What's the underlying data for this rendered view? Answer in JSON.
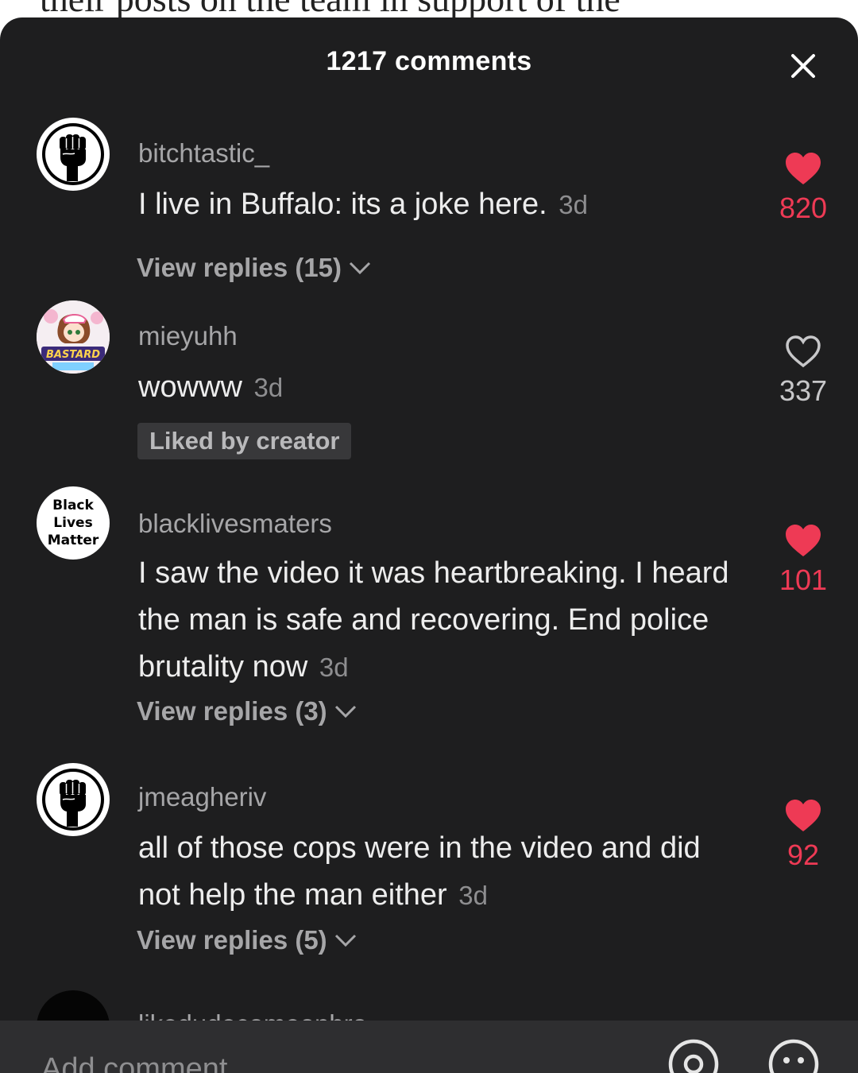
{
  "background_article": {
    "text": "their posts on the team in support of the"
  },
  "header": {
    "title": "1217 comments"
  },
  "comments": [
    {
      "username": "bitchtastic_",
      "text": "I live in Buffalo: its a joke here.",
      "time": "3d",
      "likes": "820",
      "liked": true,
      "view_replies": "View replies (15)",
      "avatar": "raised-fist"
    },
    {
      "username": "mieyuhh",
      "text": "wowww",
      "time": "3d",
      "likes": "337",
      "liked": false,
      "badge": "Liked by creator",
      "avatar": "anime-character",
      "avatar_text": "BASTARD"
    },
    {
      "username": "blacklivesmaters",
      "text": "I saw the video it was heartbreaking. I heard the man is safe and recovering. End police brutality now",
      "time": "3d",
      "likes": "101",
      "liked": true,
      "view_replies": "View replies (3)",
      "avatar": "text-logo",
      "avatar_lines": [
        "Black",
        "Lives",
        "Matter"
      ]
    },
    {
      "username": "jmeagheriv",
      "text": "all of those cops were in the video and did not help the man either",
      "time": "3d",
      "likes": "92",
      "liked": true,
      "view_replies": "View replies (5)",
      "avatar": "raised-fist"
    },
    {
      "username": "likedudecomeonbro",
      "avatar": "dark-circle"
    }
  ],
  "input": {
    "placeholder": "Add comment..."
  },
  "colors": {
    "sheet_bg": "#1e1e1f",
    "like_red": "#ee3a55",
    "text_primary": "#ededed",
    "text_secondary": "#a6a6a8",
    "input_bg": "#2e2e30"
  },
  "icons": {
    "close": "close-icon",
    "like": "heart-icon",
    "chevron": "chevron-down-icon",
    "mention": "at-sign-icon",
    "emoji": "emoji-smile-icon"
  }
}
